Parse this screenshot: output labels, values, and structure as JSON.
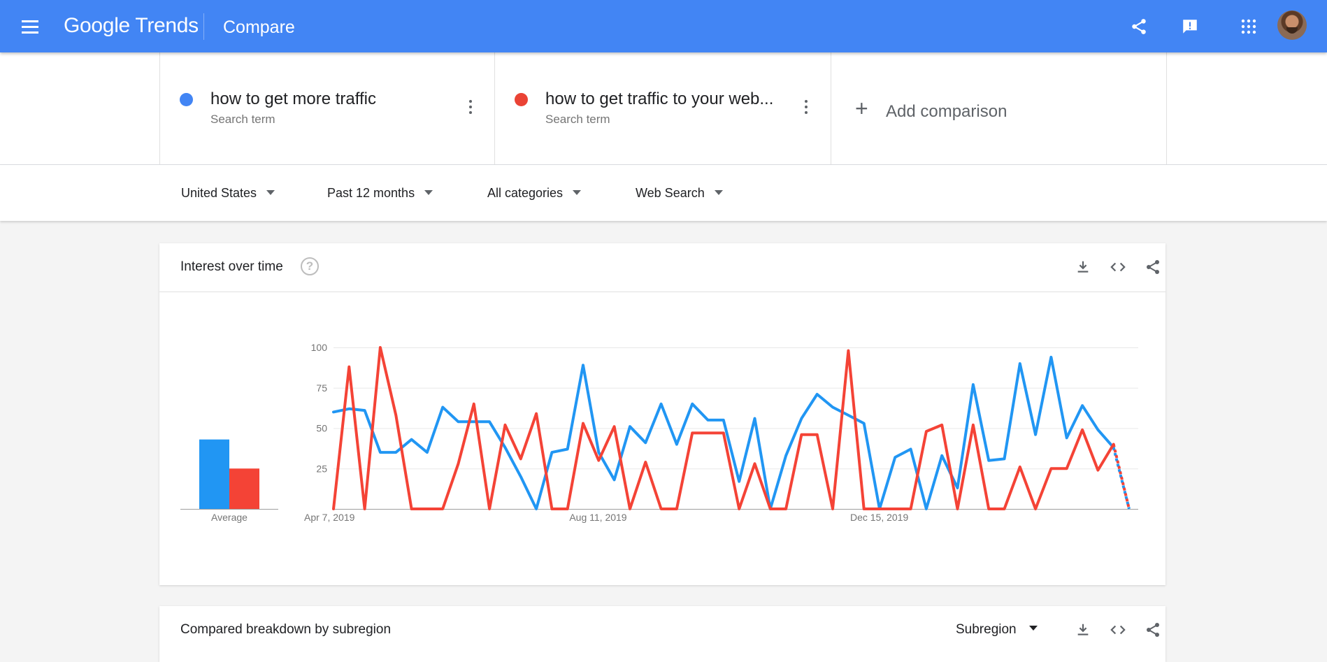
{
  "header": {
    "logo_text": "Google Trends",
    "page_title": "Compare",
    "bg_color": "#4285f4"
  },
  "terms": [
    {
      "name": "how to get more traffic",
      "type": "Search term",
      "color": "#4285f4"
    },
    {
      "name": "how to get traffic to your web...",
      "type": "Search term",
      "color": "#ea4335"
    }
  ],
  "add_comparison": "Add comparison",
  "filters": {
    "region": "United States",
    "time": "Past 12 months",
    "category": "All categories",
    "search_type": "Web Search"
  },
  "interest_card": {
    "title": "Interest over time"
  },
  "breakdown_card": {
    "title": "Compared breakdown by subregion",
    "select": "Subregion"
  },
  "chart_data": [
    {
      "type": "bar",
      "categories": [
        "Average"
      ],
      "series": [
        {
          "color": "#2196f3",
          "values": [
            43
          ]
        },
        {
          "color": "#f44336",
          "values": [
            25
          ]
        }
      ],
      "ylim": [
        0,
        100
      ]
    },
    {
      "type": "line",
      "x_tick_labels": [
        "Apr 7, 2019",
        "Aug 11, 2019",
        "Dec 15, 2019"
      ],
      "y_ticks": [
        25,
        50,
        75,
        100
      ],
      "ylim": [
        0,
        100
      ],
      "grid": true,
      "partial_last_point": true,
      "series": [
        {
          "color": "#2196f3",
          "values": [
            60,
            62,
            61,
            35,
            35,
            43,
            35,
            63,
            54,
            54,
            54,
            38,
            20,
            0,
            35,
            37,
            89,
            35,
            18,
            51,
            41,
            65,
            40,
            65,
            55,
            55,
            17,
            56,
            0,
            33,
            56,
            71,
            63,
            58,
            53,
            0,
            32,
            37,
            0,
            33,
            13,
            77,
            30,
            31,
            90,
            46,
            94,
            44,
            64,
            49,
            38,
            0
          ]
        },
        {
          "color": "#f44336",
          "values": [
            0,
            88,
            0,
            100,
            58,
            0,
            0,
            0,
            28,
            65,
            0,
            52,
            31,
            59,
            0,
            0,
            53,
            30,
            51,
            0,
            29,
            0,
            0,
            47,
            47,
            47,
            0,
            28,
            0,
            0,
            46,
            46,
            0,
            98,
            0,
            0,
            0,
            0,
            48,
            52,
            0,
            52,
            0,
            0,
            26,
            0,
            25,
            25,
            49,
            24,
            40,
            0
          ]
        }
      ]
    }
  ]
}
